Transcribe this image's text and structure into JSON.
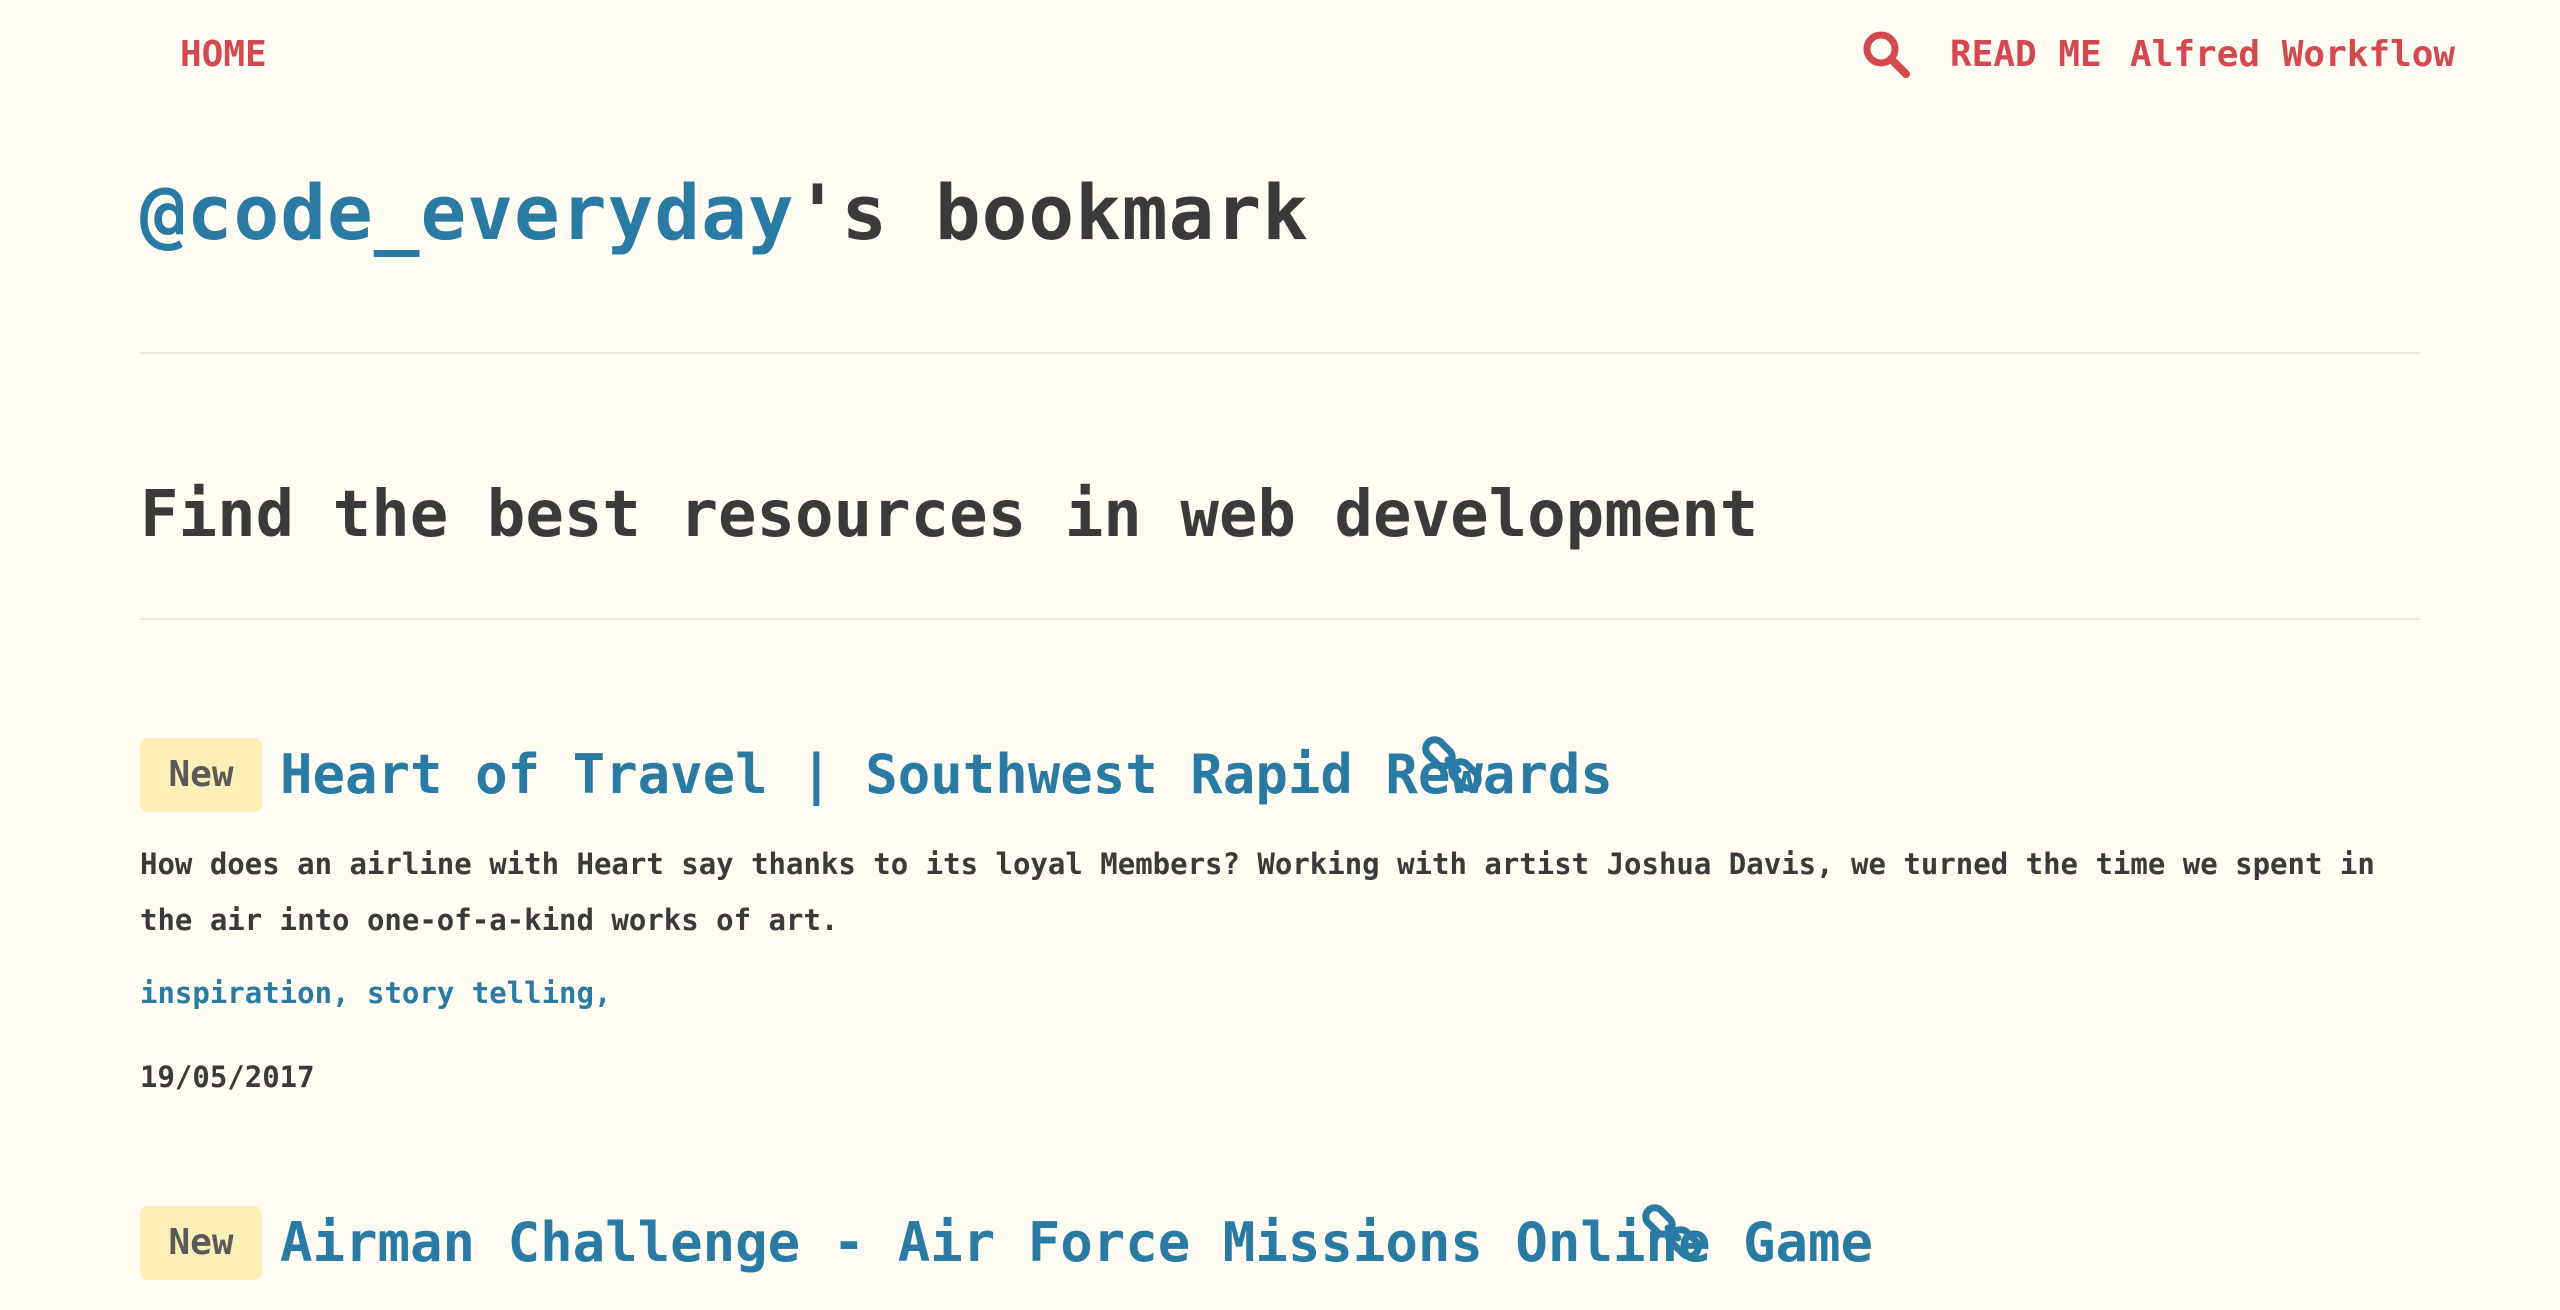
{
  "nav": {
    "home_label": "HOME",
    "search_icon": "search-icon",
    "readme_label": "READ ME",
    "alfred_label": "Alfred Workflow"
  },
  "header": {
    "handle": "@code_everyday",
    "title_suffix": "'s bookmark",
    "subtitle": "Find the best resources in web development"
  },
  "entries": [
    {
      "badge": "New",
      "title": "Heart of Travel | Southwest Rapid Rewards",
      "link_icon": "link-icon",
      "description": "How does an airline with Heart say thanks to its loyal Members? Working with artist Joshua Davis, we turned the time we spent in the air into one-of-a-kind works of art.",
      "tags": [
        "inspiration,",
        "story telling,"
      ],
      "date": "19/05/2017"
    },
    {
      "badge": "New",
      "title": "Airman Challenge - Air Force Missions Online Game",
      "link_icon": "link-icon"
    }
  ],
  "colors": {
    "background": "#fefcf3",
    "accent_red": "#d4484f",
    "link_blue": "#2a7ba4",
    "text_dark": "#3a3a3a",
    "badge_bg": "#fdefb8"
  }
}
